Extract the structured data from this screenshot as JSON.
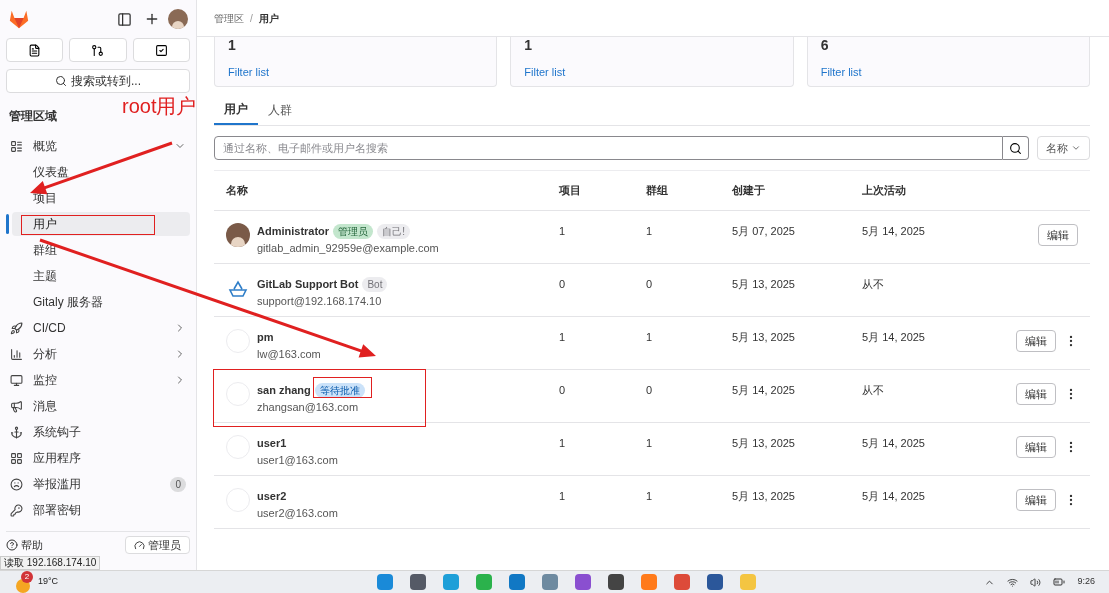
{
  "sidebar": {
    "search_button": "搜索或转到...",
    "section_title": "管理区域",
    "items": [
      {
        "label": "概览",
        "kind": "overview",
        "expanded": true,
        "children": [
          {
            "label": "仪表盘",
            "selected": false
          },
          {
            "label": "项目",
            "selected": false
          },
          {
            "label": "用户",
            "selected": true
          },
          {
            "label": "群组",
            "selected": false
          },
          {
            "label": "主题",
            "selected": false
          },
          {
            "label": "Gitaly 服务器",
            "selected": false
          }
        ]
      },
      {
        "label": "CI/CD",
        "kind": "rocket",
        "expanded": false
      },
      {
        "label": "分析",
        "kind": "chart",
        "expanded": false
      },
      {
        "label": "监控",
        "kind": "monitor",
        "expanded": false
      },
      {
        "label": "消息",
        "kind": "megaphone"
      },
      {
        "label": "系统钩子",
        "kind": "anchor"
      },
      {
        "label": "应用程序",
        "kind": "grid"
      },
      {
        "label": "举报滥用",
        "kind": "frown",
        "count": "0"
      },
      {
        "label": "部署密钥",
        "kind": "key"
      }
    ],
    "footer": [
      "帮助",
      "管理员"
    ]
  },
  "breadcrumb": [
    "管理区",
    "/",
    "用户"
  ],
  "stats": [
    {
      "value": "1",
      "link": "Filter list"
    },
    {
      "value": "1",
      "link": "Filter list"
    },
    {
      "value": "6",
      "link": "Filter list"
    }
  ],
  "tabs": [
    {
      "label": "用户",
      "selected": true
    },
    {
      "label": "人群",
      "selected": false
    }
  ],
  "search": {
    "placeholder": "通过名称、电子邮件或用户名搜索"
  },
  "sort": {
    "label": "名称"
  },
  "table": {
    "columns": [
      "名称",
      "项目",
      "群组",
      "创建于",
      "上次活动"
    ],
    "rows": [
      {
        "kind": "photo",
        "name": "Administrator",
        "badges": [
          {
            "label": "管理员",
            "kind": "admin"
          },
          {
            "label": "自己!",
            "kind": "neutral"
          }
        ],
        "email": "gitlab_admin_92959e@example.com",
        "projects": "1",
        "groups": "1",
        "created": "5月 07, 2025",
        "last_activity": "5月 14, 2025",
        "edit": "编辑",
        "menu": false
      },
      {
        "kind": "bot",
        "name": "GitLab Support Bot",
        "badges": [
          {
            "label": "Bot",
            "kind": "neutral"
          }
        ],
        "email": "support@192.168.174.10",
        "projects": "0",
        "groups": "0",
        "created": "5月 13, 2025",
        "last_activity": "从不",
        "menu": false
      },
      {
        "kind": "blank",
        "name": "pm",
        "badges": [],
        "email": "lw@163.com",
        "projects": "1",
        "groups": "1",
        "created": "5月 13, 2025",
        "last_activity": "5月 14, 2025",
        "edit": "编辑",
        "menu": true
      },
      {
        "kind": "blank",
        "name": "san zhang",
        "badges": [
          {
            "label": "等待批准",
            "kind": "info"
          }
        ],
        "email": "zhangsan@163.com",
        "projects": "0",
        "groups": "0",
        "created": "5月 14, 2025",
        "last_activity": "从不",
        "edit": "编辑",
        "menu": true
      },
      {
        "kind": "blank",
        "name": "user1",
        "badges": [],
        "email": "user1@163.com",
        "projects": "1",
        "groups": "1",
        "created": "5月 13, 2025",
        "last_activity": "5月 14, 2025",
        "edit": "编辑",
        "menu": true
      },
      {
        "kind": "blank",
        "name": "user2",
        "badges": [],
        "email": "user2@163.com",
        "projects": "1",
        "groups": "1",
        "created": "5月 13, 2025",
        "last_activity": "5月 14, 2025",
        "edit": "编辑",
        "menu": true
      }
    ]
  },
  "status_bar": "读取 192.168.174.10",
  "taskbar": {
    "weather_badge": "2",
    "temperature": "19°C",
    "time": "9:26"
  },
  "annotation": {
    "label": "root用户"
  }
}
